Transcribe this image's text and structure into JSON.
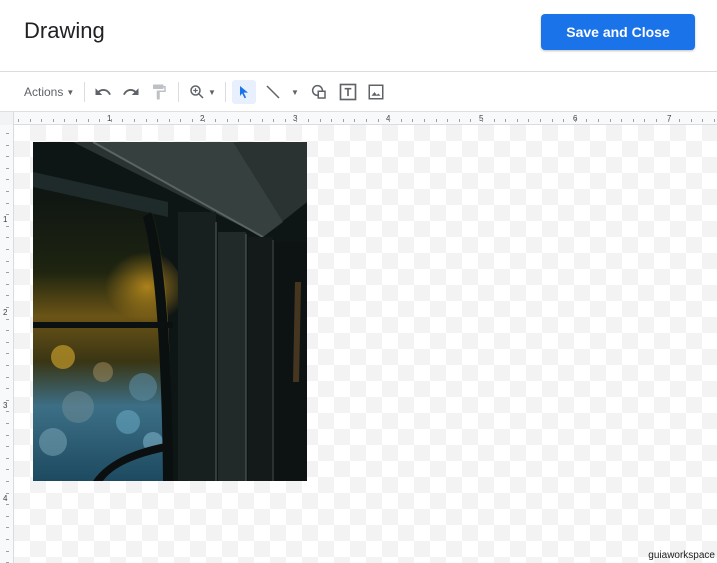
{
  "header": {
    "title": "Drawing",
    "save_close_label": "Save and Close"
  },
  "toolbar": {
    "actions_label": "Actions",
    "icons": [
      "undo-icon",
      "redo-icon",
      "paint-format-icon",
      "zoom-icon",
      "select-icon",
      "line-icon",
      "shape-icon",
      "text-box-icon",
      "image-icon"
    ]
  },
  "ruler": {
    "horizontal_labels": [
      "1",
      "2",
      "3",
      "4",
      "5",
      "6",
      "7"
    ],
    "vertical_labels": [
      "1",
      "2",
      "3",
      "4"
    ]
  },
  "colors": {
    "accent": "#1a73e8",
    "toolbar_icon": "#5f6368",
    "active_tool": "#1a73e8"
  },
  "watermark": "guiaworkspace"
}
